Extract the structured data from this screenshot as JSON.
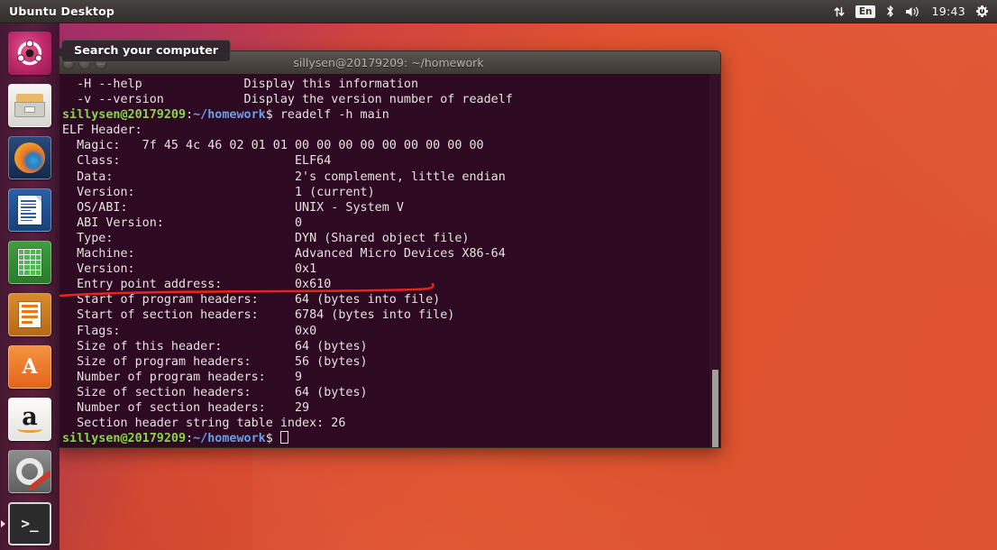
{
  "panel": {
    "title": "Ubuntu Desktop",
    "tray": {
      "network_icon": "network-updown-icon",
      "keyboard_layout": "En",
      "bluetooth_icon": "bluetooth-icon",
      "volume_icon": "volume-icon",
      "clock": "19:43",
      "session_icon": "gear-power-icon"
    }
  },
  "tooltip": {
    "text": "Search your computer"
  },
  "launcher": {
    "items": [
      {
        "name": "ubuntu-dash",
        "label": "Ubuntu Dash",
        "active": false
      },
      {
        "name": "files",
        "label": "Files",
        "active": false
      },
      {
        "name": "firefox",
        "label": "Firefox Web Browser",
        "active": false
      },
      {
        "name": "libreoffice-writer",
        "label": "LibreOffice Writer",
        "active": false
      },
      {
        "name": "libreoffice-calc",
        "label": "LibreOffice Calc",
        "active": false
      },
      {
        "name": "libreoffice-impress",
        "label": "LibreOffice Impress",
        "active": false
      },
      {
        "name": "ubuntu-software",
        "label": "Ubuntu Software Center",
        "active": false
      },
      {
        "name": "amazon",
        "label": "Amazon",
        "active": false
      },
      {
        "name": "system-settings",
        "label": "System Settings",
        "active": false
      },
      {
        "name": "terminal",
        "label": "Terminal",
        "active": true
      }
    ]
  },
  "terminal": {
    "title": "sillysen@20179209: ~/homework",
    "window_buttons": [
      "close",
      "minimize",
      "maximize"
    ],
    "prompt_user_host": "sillysen@20179209",
    "prompt_sep": ":",
    "prompt_path": "~/homework",
    "prompt_dollar": "$",
    "command": " readelf -h main",
    "scrollback_lines": [
      "  -H --help              Display this information",
      "  -v --version           Display the version number of readelf"
    ],
    "output_title": "ELF Header:",
    "fields": [
      {
        "label": "  Magic:   7f 45 4c 46 02 01 01 00 00 00 00 00 00 00 00 00",
        "value": ""
      },
      {
        "label": "  Class:",
        "value": "ELF64"
      },
      {
        "label": "  Data:",
        "value": "2's complement, little endian"
      },
      {
        "label": "  Version:",
        "value": "1 (current)"
      },
      {
        "label": "  OS/ABI:",
        "value": "UNIX - System V"
      },
      {
        "label": "  ABI Version:",
        "value": "0"
      },
      {
        "label": "  Type:",
        "value": "DYN (Shared object file)"
      },
      {
        "label": "  Machine:",
        "value": "Advanced Micro Devices X86-64"
      },
      {
        "label": "  Version:",
        "value": "0x1"
      },
      {
        "label": "  Entry point address:",
        "value": "0x610"
      },
      {
        "label": "  Start of program headers:",
        "value": "64 (bytes into file)"
      },
      {
        "label": "  Start of section headers:",
        "value": "6784 (bytes into file)"
      },
      {
        "label": "  Flags:",
        "value": "0x0"
      },
      {
        "label": "  Size of this header:",
        "value": "64 (bytes)"
      },
      {
        "label": "  Size of program headers:",
        "value": "56 (bytes)"
      },
      {
        "label": "  Number of program headers:",
        "value": "9"
      },
      {
        "label": "  Size of section headers:",
        "value": "64 (bytes)"
      },
      {
        "label": "  Number of section headers:",
        "value": "29"
      },
      {
        "label": "  Section header string table index: 26",
        "value": ""
      }
    ],
    "annotation": {
      "type": "hand-drawn-underline",
      "color": "#e8221c",
      "target": "Entry point address: 0x610"
    }
  },
  "colors": {
    "terminal_bg": "#2d0922",
    "prompt_green": "#89d64a",
    "prompt_blue": "#6b9fe8",
    "panel_bg": "#3c3835",
    "launcher_bg": "#521c3c",
    "wallpaper_orange": "#dd5230",
    "annotation_red": "#e8221c"
  }
}
